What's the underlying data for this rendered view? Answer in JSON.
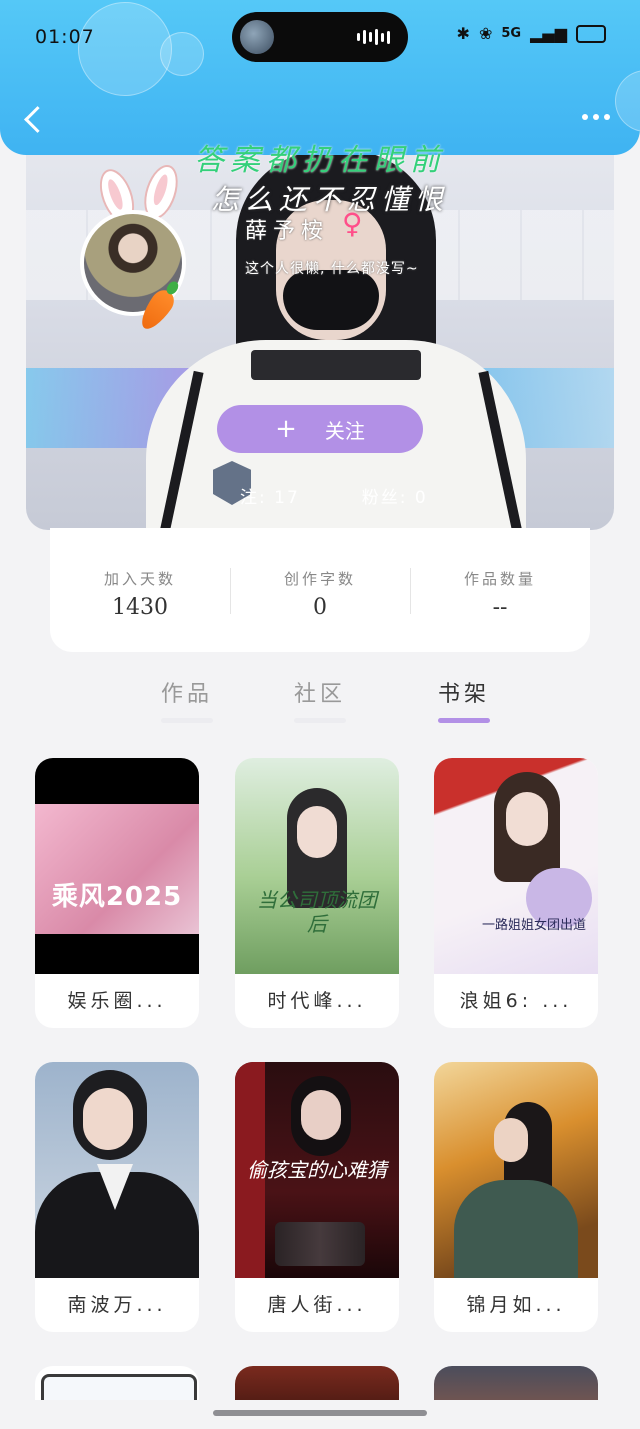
{
  "status_bar": {
    "time": "01:07",
    "network": "5G"
  },
  "profile": {
    "title_line1": "答案都扔在眼前",
    "title_line2": "怎么还不忍懂恨",
    "name": "薛予桉",
    "gender_symbol": "♀",
    "bio": "这个人很懒, 什么都没写~",
    "follow_plus": "+",
    "follow_label": "关注",
    "following_text": "注: 17",
    "followers_text": "粉丝: 0"
  },
  "stats": [
    {
      "label": "加入天数",
      "value": "1430"
    },
    {
      "label": "创作字数",
      "value": "0"
    },
    {
      "label": "作品数量",
      "value": "--"
    }
  ],
  "tabs": [
    {
      "label": "作品",
      "active": false
    },
    {
      "label": "社区",
      "active": false
    },
    {
      "label": "书架",
      "active": true
    }
  ],
  "books": [
    {
      "title": "娱乐圈..."
    },
    {
      "title": "时代峰..."
    },
    {
      "title": "浪姐6: ..."
    },
    {
      "title": "南波万..."
    },
    {
      "title": "唐人街..."
    },
    {
      "title": "锦月如..."
    }
  ],
  "cover_texts": {
    "book1": "乘风2025",
    "book2": "当公司顶流团后",
    "book3": "一路姐姐女团出道",
    "book5": "偷孩宝的心难猜"
  },
  "colors": {
    "accent": "#b290e6",
    "header": "#45bdf5",
    "title_green": "#34d07a"
  }
}
